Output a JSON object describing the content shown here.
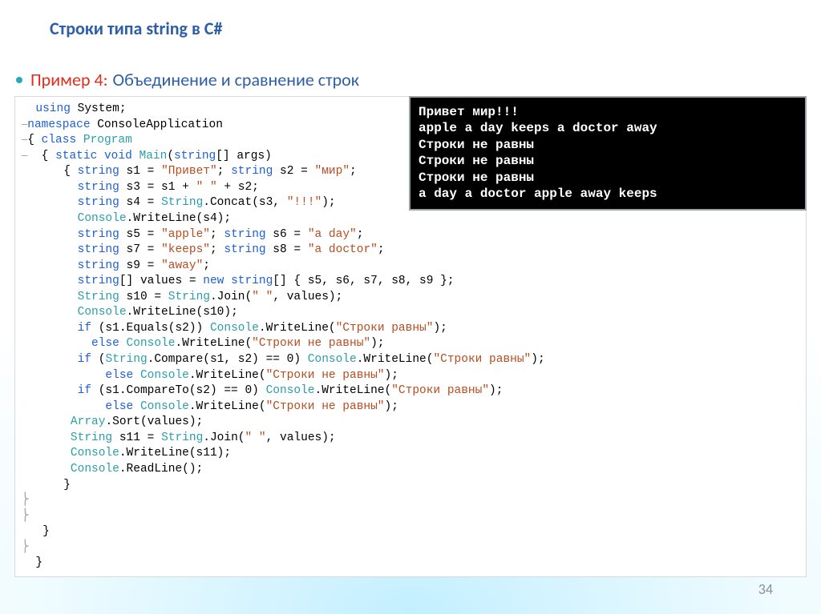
{
  "title": "Строки типа string в C#",
  "example_label": "Пример 4:",
  "example_title": "Объединение и сравнение строк",
  "code": {
    "l1_kw_using": "using",
    "l1_sys": " System;",
    "l2_kw_ns": "namespace",
    "l2_ns": " ConsoleApplication",
    "l3_kw_class": "class",
    "l3_cls": " Program",
    "l4_kw_static": "static",
    "l4_kw_void": " void",
    "l4_main": " Main",
    "l4_kw_string": "string",
    "l4_args": "[] args)",
    "l5_kw_string": "string",
    "l5_s1a": " s1 = ",
    "l5_str1": "\"Привет\"",
    "l5_semi": "; ",
    "l5_kw_string2": "string",
    "l5_s2a": " s2 = ",
    "l5_str2": "\"мир\"",
    "l5_end": ";",
    "l6_kw_string": "string",
    "l6_body": " s3 = s1 + ",
    "l6_space": "\" \"",
    "l6_body2": " + s2;",
    "l7_kw_string": "string",
    "l7_body": " s4 = ",
    "l7_String": "String",
    "l7_concat": ".Concat(s3, ",
    "l7_exc": "\"!!!\"",
    "l7_end": ");",
    "l8_Console": "Console",
    "l8_wr": ".WriteLine(s4);",
    "l9_kw_string": "string",
    "l9_a": " s5 = ",
    "l9_str5": "\"apple\"",
    "l9_semi": "; ",
    "l9_kw_string2": "string",
    "l9_b": " s6 = ",
    "l9_str6": "\"a day\"",
    "l9_end": ";",
    "l10_kw_string": "string",
    "l10_a": " s7 = ",
    "l10_str7": "\"keeps\"",
    "l10_semi": "; ",
    "l10_kw_string2": "string",
    "l10_b": " s8 = ",
    "l10_str8": "\"a doctor\"",
    "l10_end": ";",
    "l11_kw_string": "string",
    "l11_a": " s9 = ",
    "l11_str9": "\"away\"",
    "l11_end": ";",
    "l12_kw_string": "string",
    "l12_a": "[] values = ",
    "l12_kw_new": "new",
    "l12_sp": " ",
    "l12_kw_string2": "string",
    "l12_b": "[] { s5, s6, s7, s8, s9 };",
    "l13_String": "String",
    "l13_a": " s10 = ",
    "l13_String2": "String",
    "l13_join": ".Join(",
    "l13_sp": "\" \"",
    "l13_b": ", values);",
    "l14_Console": "Console",
    "l14_wr": ".WriteLine(s10);",
    "l15_kw_if": "if",
    "l15_a": " (s1.Equals(s2)) ",
    "l15_Console": "Console",
    "l15_wr": ".WriteLine(",
    "l15_eq": "\"Строки равны\"",
    "l15_end": ");",
    "l16_kw_else": "else",
    "l16_sp": " ",
    "l16_Console": "Console",
    "l16_wr": ".WriteLine(",
    "l16_neq": "\"Строки не равны\"",
    "l16_end": ");",
    "l17_kw_if": "if",
    "l17_a": " (",
    "l17_String": "String",
    "l17_cmp": ".Compare(s1, s2) == 0) ",
    "l17_Console": "Console",
    "l17_wr": ".WriteLine(",
    "l17_eq": "\"Строки равны\"",
    "l17_end": ");",
    "l18_kw_else": "else",
    "l18_sp": " ",
    "l18_Console": "Console",
    "l18_wr": ".WriteLine(",
    "l18_neq": "\"Строки не равны\"",
    "l18_end": ");",
    "l19_kw_if": "if",
    "l19_a": " (s1.CompareTo(s2) == 0) ",
    "l19_Console": "Console",
    "l19_wr": ".WriteLine(",
    "l19_eq": "\"Строки равны\"",
    "l19_end": ");",
    "l20_kw_else": "else",
    "l20_sp": " ",
    "l20_Console": "Console",
    "l20_wr": ".WriteLine(",
    "l20_neq": "\"Строки не равны\"",
    "l20_end": ");",
    "l21_Array": "Array",
    "l21_sort": ".Sort(values);",
    "l22_String": "String",
    "l22_a": " s11 = ",
    "l22_String2": "String",
    "l22_join": ".Join(",
    "l22_sp": "\" \"",
    "l22_b": ", values);",
    "l23_Console": "Console",
    "l23_wr": ".WriteLine(s11);",
    "l24_Console": "Console",
    "l24_rl": ".ReadLine();",
    "brace_close1": "}",
    "brace_close2": "}",
    "brace_close3": "}",
    "gutter_bracket": "⎯",
    "nbsp": " "
  },
  "console_output": [
    "Привет мир!!!",
    "apple a day keeps a doctor away",
    "Строки не равны",
    "Строки не равны",
    "Строки не равны",
    "a day a doctor apple away keeps"
  ],
  "page_number": "34"
}
